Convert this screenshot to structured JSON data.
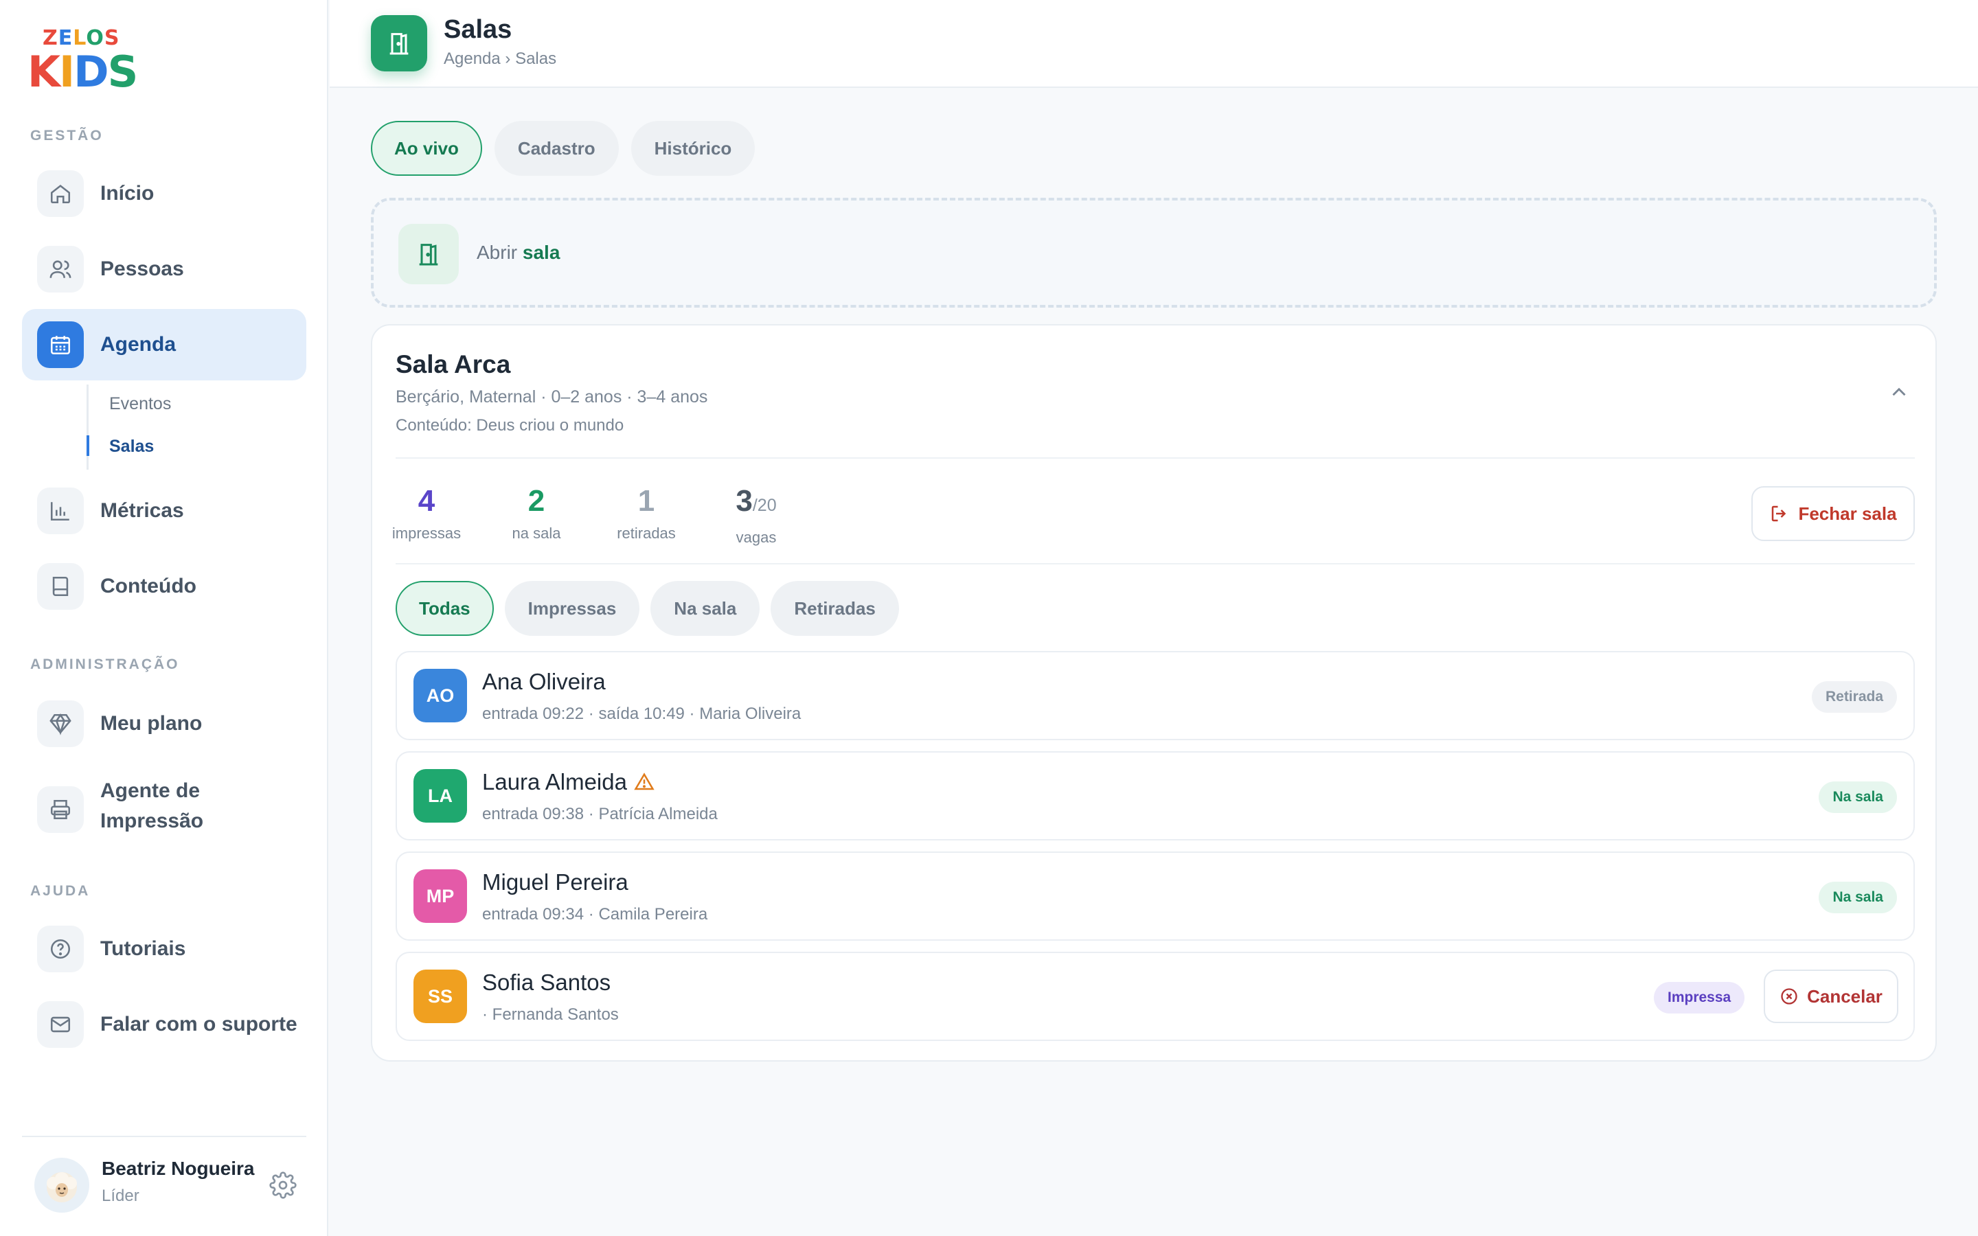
{
  "logo": {
    "top": "ZELOS",
    "bottom": "KIDS"
  },
  "sidebar": {
    "section_gestao": "GESTÃO",
    "section_admin": "ADMINISTRAÇÃO",
    "section_ajuda": "AJUDA",
    "items": {
      "inicio": "Início",
      "pessoas": "Pessoas",
      "agenda": "Agenda",
      "eventos": "Eventos",
      "salas": "Salas",
      "metricas": "Métricas",
      "conteudo": "Conteúdo",
      "meu_plano": "Meu plano",
      "agente_line1": "Agente de",
      "agente_line2": "Impressão",
      "tutoriais": "Tutoriais",
      "suporte": "Falar com o suporte"
    },
    "user": {
      "name": "Beatriz Nogueira",
      "role": "Líder"
    }
  },
  "header": {
    "title": "Salas",
    "breadcrumb": "Agenda › Salas"
  },
  "tabs": {
    "live": "Ao vivo",
    "cadastro": "Cadastro",
    "historico": "Histórico"
  },
  "open_room": {
    "prefix": "Abrir",
    "highlight": "sala"
  },
  "room": {
    "name": "Sala Arca",
    "subtitle": "Berçário, Maternal · 0–2 anos · 3–4 anos",
    "content": "Conteúdo: Deus criou o mundo",
    "stats": {
      "impressas_value": "4",
      "impressas_label": "impressas",
      "nasala_value": "2",
      "nasala_label": "na sala",
      "retiradas_value": "1",
      "retiradas_label": "retiradas",
      "vagas_value": "3",
      "vagas_total": "/20",
      "vagas_label": "vagas"
    },
    "close_label": "Fechar sala",
    "filters": {
      "todas": "Todas",
      "impressas": "Impressas",
      "nasala": "Na sala",
      "retiradas": "Retiradas"
    },
    "children": [
      {
        "initials": "AO",
        "name": "Ana Oliveira",
        "detail": "entrada 09:22 · saída 10:49 · Maria Oliveira",
        "status": "Retirada",
        "color": "#3a86dc"
      },
      {
        "initials": "LA",
        "name": "Laura Almeida",
        "detail": "entrada 09:38 · Patrícia Almeida",
        "status": "Na sala",
        "color": "#1fa86f"
      },
      {
        "initials": "MP",
        "name": "Miguel Pereira",
        "detail": "entrada 09:34 · Camila Pereira",
        "status": "Na sala",
        "color": "#e45aa8"
      },
      {
        "initials": "SS",
        "name": "Sofia Santos",
        "detail": "· Fernanda Santos",
        "status": "Impressa",
        "color": "#f0a020"
      }
    ],
    "cancel_label": "Cancelar"
  },
  "colors": {
    "brand_green": "#22a06b",
    "brand_blue": "#2f7be0",
    "impressas": "#5a45c9",
    "nasala": "#1a9a63",
    "retiradas": "#9aa5b1",
    "vagas": "#4a5663"
  }
}
